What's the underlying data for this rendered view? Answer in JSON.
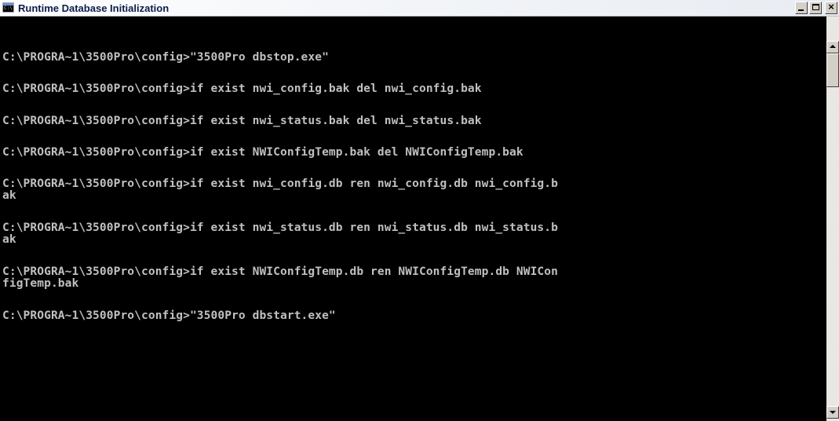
{
  "window": {
    "title": "Runtime Database Initialization",
    "icon": "console-icon"
  },
  "title_buttons": {
    "minimize": "minimize-icon",
    "maximize": "maximize-icon",
    "close": "×"
  },
  "console": {
    "lines": [
      "C:\\PROGRA~1\\3500Pro\\config>\"3500Pro dbstop.exe\"",
      "C:\\PROGRA~1\\3500Pro\\config>if exist nwi_config.bak del nwi_config.bak",
      "C:\\PROGRA~1\\3500Pro\\config>if exist nwi_status.bak del nwi_status.bak",
      "C:\\PROGRA~1\\3500Pro\\config>if exist NWIConfigTemp.bak del NWIConfigTemp.bak",
      "C:\\PROGRA~1\\3500Pro\\config>if exist nwi_config.db ren nwi_config.db nwi_config.b",
      "ak",
      "C:\\PROGRA~1\\3500Pro\\config>if exist nwi_status.db ren nwi_status.db nwi_status.b",
      "ak",
      "C:\\PROGRA~1\\3500Pro\\config>if exist NWIConfigTemp.db ren NWIConfigTemp.db NWICon",
      "figTemp.bak",
      "C:\\PROGRA~1\\3500Pro\\config>\"3500Pro dbstart.exe\""
    ]
  },
  "colors": {
    "console_bg": "#000000",
    "console_text": "#c0c0c0",
    "title_text": "#0b1c4a"
  }
}
